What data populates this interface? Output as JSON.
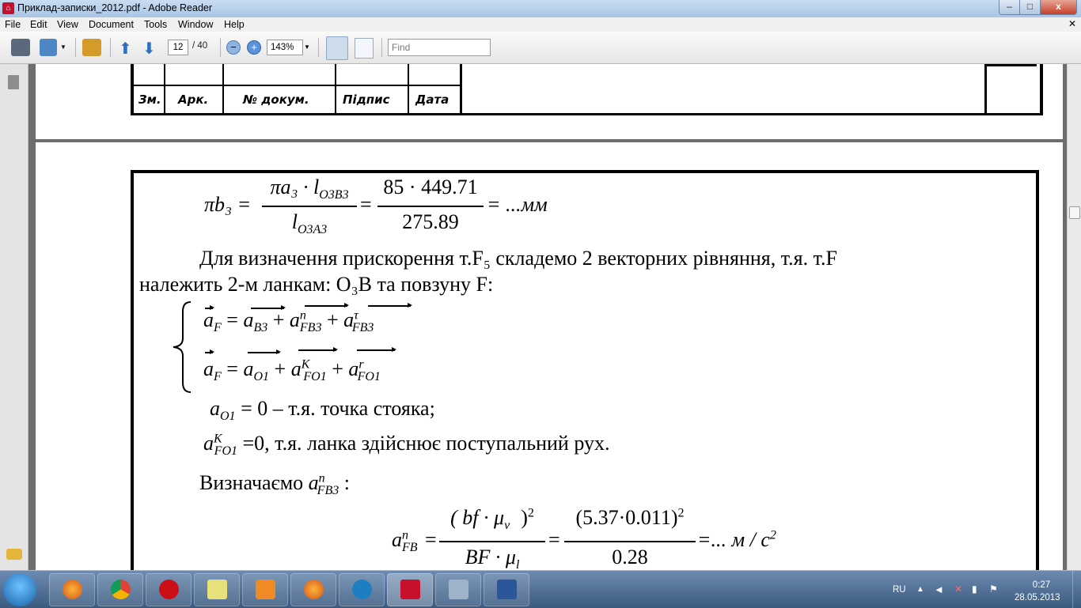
{
  "window": {
    "title": "Приклад-записки_2012.pdf - Adobe Reader",
    "min": "–",
    "max": "□",
    "close": "x"
  },
  "menu": {
    "items": [
      "File",
      "Edit",
      "View",
      "Document",
      "Tools",
      "Window",
      "Help"
    ]
  },
  "toolbar": {
    "page_current": "12",
    "page_total": "/ 40",
    "zoom": "143%",
    "find_placeholder": "Find"
  },
  "stamp": {
    "headers": [
      "Зм.",
      "Арк.",
      "№ докум.",
      "Підпис",
      "Дата"
    ]
  },
  "content": {
    "eq1": {
      "lhs": "πb₃ =",
      "num1": "πa₃ · l",
      "num1_sub": "O3B3",
      "den1": "l",
      "den1_sub": "O3A3",
      "num2": "85 · 449.71",
      "den2": "275.89",
      "rhs": "= ...мм"
    },
    "para1_line1": "Для  визначення  прискорення  т.F₅  складемо  2  векторних  рівняння,  т.я.  т.F",
    "para1_line2": "належить 2-м ланкам:  O₃B та повзуну F:",
    "sys1": {
      "a": "a",
      "a_sub": "F",
      "eq": "=",
      "t1": "a",
      "t1_sub": "B3",
      "t2": "a",
      "t2_sup": "n",
      "t2_sub": "FB3",
      "t3": "a",
      "t3_sup": "τ",
      "t3_sub": "FB3"
    },
    "sys2": {
      "a": "a",
      "a_sub": "F",
      "eq": "=",
      "t1": "a",
      "t1_sub": "O1",
      "t2": "a",
      "t2_sup": "K",
      "t2_sub": "FO1",
      "t3": "a",
      "t3_sup": "r",
      "t3_sub": "FO1"
    },
    "line_ao1": {
      "sym": "a",
      "sub": "O1",
      "text": "= 0 – т.я. точка стояка;"
    },
    "line_ak": {
      "sym": "a",
      "sup": "K",
      "sub": "FO1",
      "text": "=0, т.я. ланка здійснює поступальний рух."
    },
    "line_def": {
      "text": "Визначаємо",
      "sym": "a",
      "sup": "n",
      "sub": "FB3",
      "colon": ":"
    },
    "eq2": {
      "lhs": "a",
      "lhs_sup": "n",
      "lhs_sub": "FB",
      "num1": "( bf · μ",
      "num1_sub": "v",
      "num1_tail": ")",
      "num1_sup": "2",
      "den1": "BF · μ",
      "den1_sub": "l",
      "num2": "(5.37·0.011)",
      "num2_sup": "2",
      "den2": "0.28",
      "rhs": "=... м / c",
      "rhs_sup": "2"
    }
  },
  "taskbar": {
    "lang": "RU",
    "time": "0:27",
    "date": "28.05.2013"
  }
}
